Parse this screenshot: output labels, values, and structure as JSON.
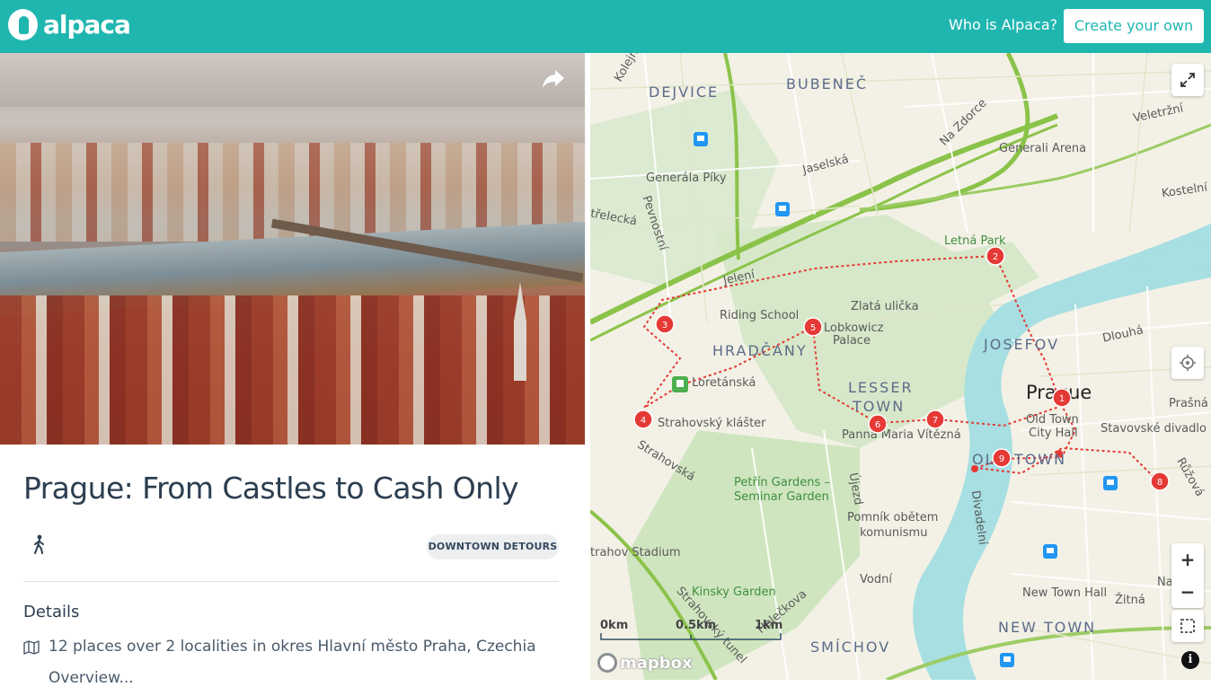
{
  "header": {
    "logo_text": "alpaca",
    "who_label": "Who is Alpaca?",
    "create_label": "Create your own"
  },
  "trip": {
    "title": "Prague: From Castles to Cash Only",
    "tag": "DOWNTOWN DETOURS",
    "details_heading": "Details",
    "details_line": "12 places over 2 localities in okres Hlavní město Praha, Czechia",
    "details_line2": "Overview..."
  },
  "map": {
    "labels": {
      "dejvice": "DEJVICE",
      "bubenec": "BUBENEČ",
      "hradcany": "HRADČANY",
      "lesser": "LESSER",
      "town": "TOWN",
      "josefov": "JOSEFOV",
      "oldtown": "OLD TOWN",
      "newtown": "NEW TOWN",
      "smichov": "SMÍCHOV",
      "prague": "Prague",
      "generala": "Generála Píky",
      "arena": "Generali Arena",
      "letna": "Letná Park",
      "riding": "Riding School",
      "lobkowicz": "Lobkowicz",
      "palace": "Palace",
      "zlata": "Zlatá ulička",
      "loretanska": "Loretánská",
      "strahov_klaster": "Strahovský klášter",
      "panna": "Panna Maria Vítězná",
      "oldtown_hall": "Old Town",
      "city_hall": "City Hall",
      "stavovske": "Stavovské divadlo",
      "petrin1": "Petřín Gardens –",
      "petrin2": "Seminar Garden",
      "pomnik1": "Pomník obětem",
      "pomnik2": "komunismu",
      "strahov_stadium": "trahov Stadium",
      "kinsky": "Kinsky Garden",
      "newtown_hall": "New Town Hall",
      "nationa": "Natio",
      "zitna": "Žitná",
      "prasna": "Prašná br",
      "veletrzni": "Veletržní",
      "kostelni": "Kostelní",
      "dlouha": "Dlouhá",
      "nazdorce": "Na Zdorce",
      "jaselska": "Jaselská",
      "jeleni": "Jelení",
      "ujezd": "Újezd",
      "divadelni": "Divadelní",
      "vodni": "Vodní",
      "ruzova": "Růžová",
      "holeckova": "Holečkova",
      "strahovsky_tunel": "Strahovský tunel",
      "strahovska": "Strahovská",
      "pevnostni": "Pevnostní",
      "strelecka": "třelecká",
      "kolejni": "Kolejní"
    },
    "markers": [
      "1",
      "2",
      "3",
      "4",
      "5",
      "6",
      "7",
      "8",
      "9"
    ],
    "scale_labels": [
      "0km",
      "0.5km",
      "1km"
    ],
    "attribution": "mapbox",
    "zoom_in": "+",
    "zoom_out": "−",
    "info": "i"
  }
}
